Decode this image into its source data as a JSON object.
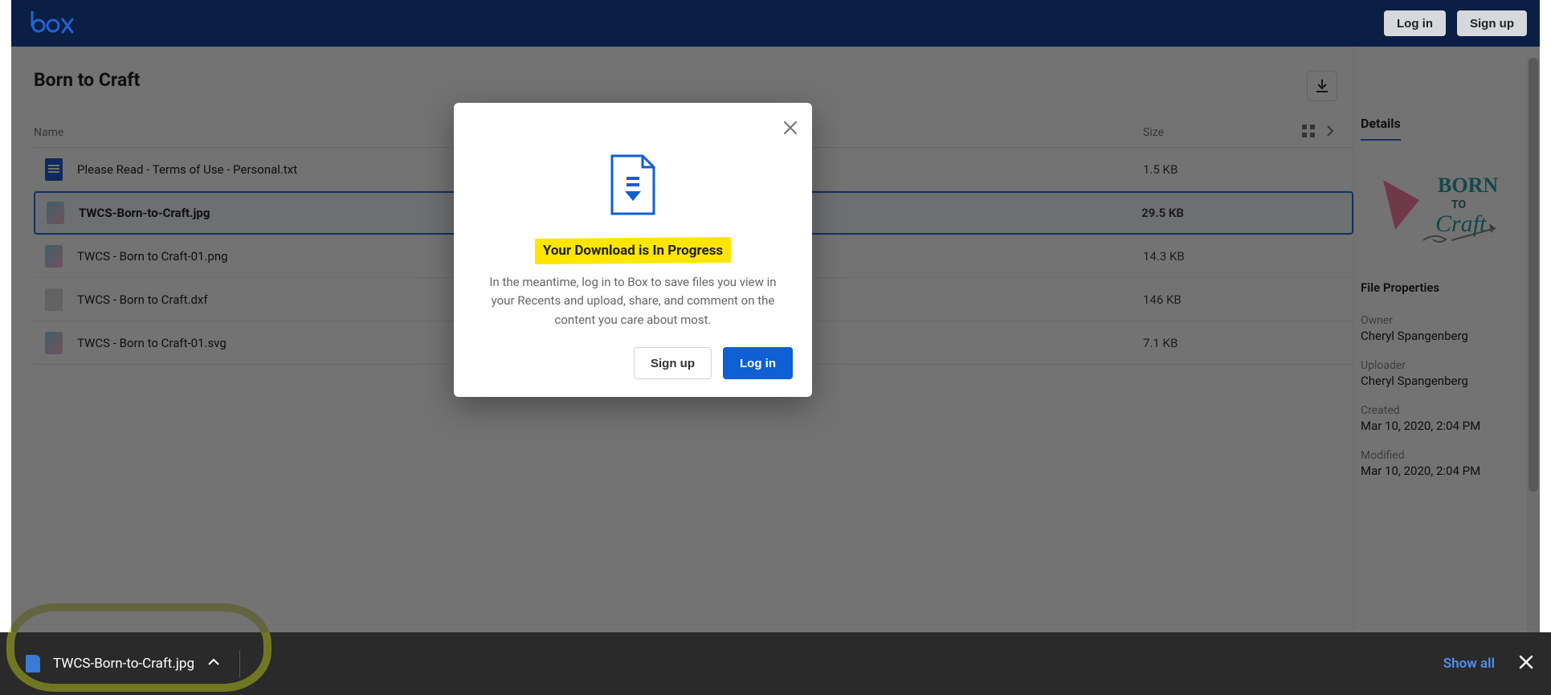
{
  "header": {
    "login_label": "Log in",
    "signup_label": "Sign up"
  },
  "page": {
    "title": "Born to Craft"
  },
  "columns": {
    "name": "Name",
    "size": "Size"
  },
  "files": [
    {
      "name": "Please Read - Terms of Use - Personal.txt",
      "size": "1.5 KB",
      "icon": "doc",
      "selected": false
    },
    {
      "name": "TWCS-Born-to-Craft.jpg",
      "size": "29.5 KB",
      "icon": "img",
      "selected": true
    },
    {
      "name": "TWCS - Born to Craft-01.png",
      "size": "14.3 KB",
      "icon": "img",
      "selected": false
    },
    {
      "name": "TWCS - Born to Craft.dxf",
      "size": "146 KB",
      "icon": "generic",
      "selected": false
    },
    {
      "name": "TWCS - Born to Craft-01.svg",
      "size": "7.1 KB",
      "icon": "img",
      "selected": false
    }
  ],
  "details": {
    "tab": "Details",
    "section": "File Properties",
    "thumb_top": "BORN",
    "thumb_mid": "TO",
    "thumb_bottom": "Craft",
    "owner_k": "Owner",
    "owner_v": "Cheryl Spangenberg",
    "uploader_k": "Uploader",
    "uploader_v": "Cheryl Spangenberg",
    "created_k": "Created",
    "created_v": "Mar 10, 2020, 2:04 PM",
    "modified_k": "Modified",
    "modified_v": "Mar 10, 2020, 2:04 PM"
  },
  "modal": {
    "title": "Your Download is In Progress",
    "body": "In the meantime, log in to Box to save files you view in your Recents and upload, share, and comment on the content you care about most.",
    "signup": "Sign up",
    "login": "Log in"
  },
  "download_bar": {
    "filename": "TWCS-Born-to-Craft.jpg",
    "show_all": "Show all"
  }
}
